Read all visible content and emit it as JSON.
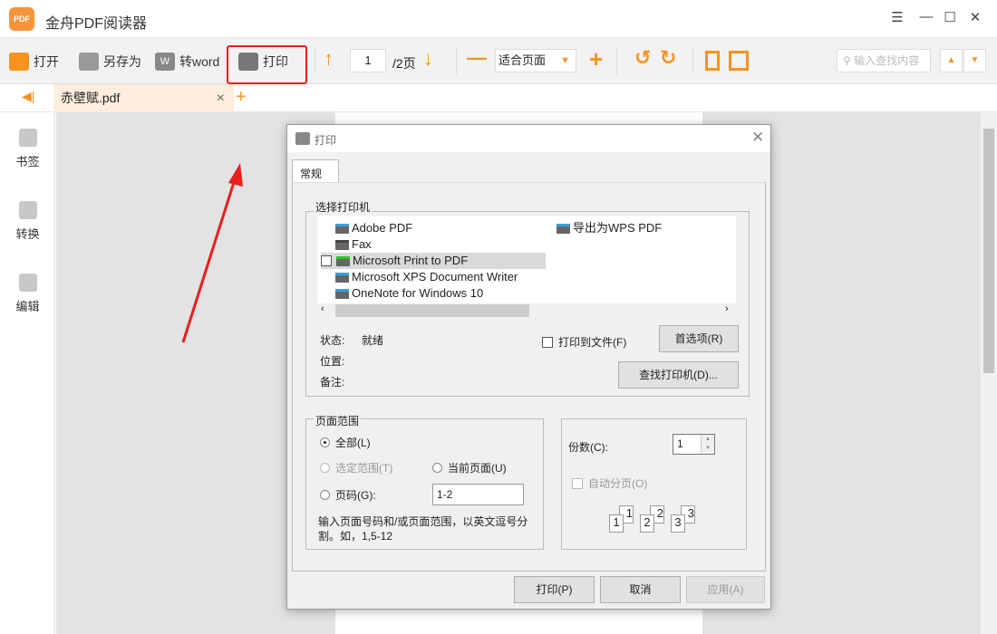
{
  "app": {
    "title": "金舟PDF阅读器",
    "logo_text": "PDF"
  },
  "window_controls": {
    "menu": "☰",
    "minimize": "—",
    "maximize": "☐",
    "close": "✕"
  },
  "toolbar": {
    "open": "打开",
    "save_as": "另存为",
    "to_word": "转word",
    "print": "打印",
    "page_current": "1",
    "page_total": "/2页",
    "zoom_mode": "适合页面",
    "search_placeholder": "输入查找内容"
  },
  "tabs": [
    {
      "label": "赤壁赋.pdf"
    }
  ],
  "sidebar": {
    "items": [
      {
        "label": "书签"
      },
      {
        "label": "转换"
      },
      {
        "label": "编辑"
      }
    ]
  },
  "dialog": {
    "title": "打印",
    "tab": "常规",
    "printer_group": "选择打印机",
    "printers": [
      {
        "name": "Adobe PDF"
      },
      {
        "name": "Fax"
      },
      {
        "name": "Microsoft Print to PDF",
        "selected": true
      },
      {
        "name": "Microsoft XPS Document Writer"
      },
      {
        "name": "OneNote for Windows 10"
      },
      {
        "name": "导出为WPS PDF"
      }
    ],
    "status_label": "状态:",
    "status_value": "就绪",
    "location_label": "位置:",
    "comment_label": "备注:",
    "print_to_file": "打印到文件(F)",
    "preferences": "首选项(R)",
    "find_printer": "查找打印机(D)...",
    "range_group": "页面范围",
    "range_all": "全部(L)",
    "range_selection": "选定范围(T)",
    "range_current": "当前页面(U)",
    "range_pages": "页码(G):",
    "range_pages_value": "1-2",
    "range_hint": "输入页面号码和/或页面范围，以英文逗号分割。如，1,5-12",
    "copies_label": "份数(C):",
    "copies_value": "1",
    "collate": "自动分页(O)",
    "collate_pages": [
      "1",
      "1",
      "2",
      "2",
      "3",
      "3"
    ],
    "print_btn": "打印(P)",
    "cancel_btn": "取消",
    "apply_btn": "应用(A)"
  }
}
